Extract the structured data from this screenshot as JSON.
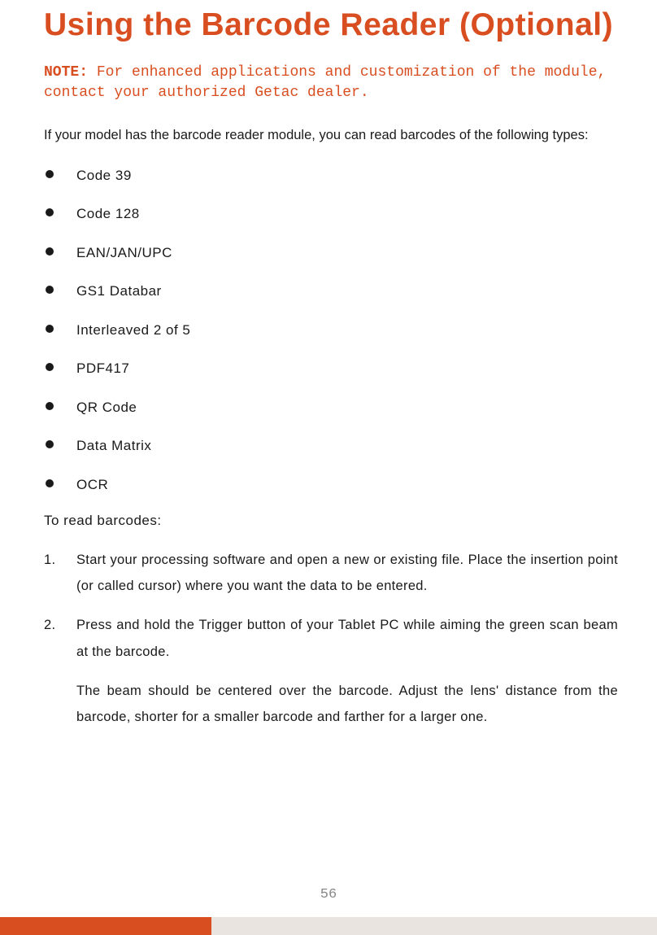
{
  "page": {
    "heading": "Using the Barcode Reader (Optional)",
    "note_label": "NOTE:",
    "note_body": " For enhanced applications and customization of the module, contact your authorized Getac dealer.",
    "intro": "If your model has the barcode reader module, you can read barcodes of the following types:",
    "types": [
      "Code 39",
      "Code 128",
      "EAN/JAN/UPC",
      "GS1 Databar",
      "Interleaved 2 of 5",
      "PDF417",
      "QR Code",
      "Data Matrix",
      "OCR"
    ],
    "to_read": "To read barcodes:",
    "steps": [
      "Start your processing software and open a new or existing file. Place the insertion point (or called cursor) where you want the data to be entered.",
      "Press and hold the Trigger button of your Tablet PC while aiming the green scan beam at the barcode."
    ],
    "step_extra": "The beam should be centered over the barcode. Adjust the lens' distance from the barcode, shorter for a smaller barcode and farther for a larger one.",
    "page_number": "56"
  },
  "colors": {
    "accent": "#d94e20",
    "footer_gray": "#e9e4df"
  }
}
